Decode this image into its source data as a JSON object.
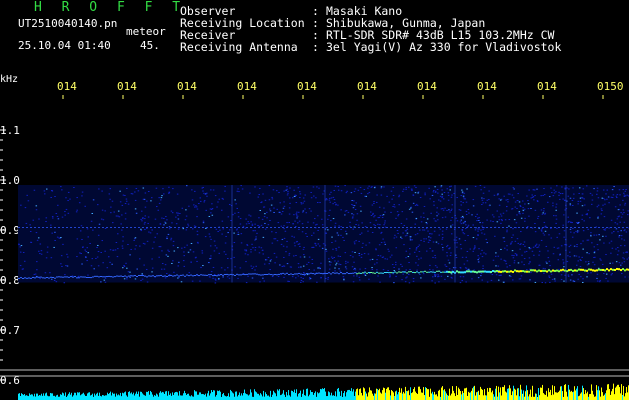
{
  "header": {
    "title": "H R O F F T",
    "filename": "UT2510040140.pn",
    "filename_suffix": "meteor",
    "datetime": "25.10.04 01:40",
    "count": "45."
  },
  "meta": [
    {
      "label": "Observer",
      "value": "Masaki Kano"
    },
    {
      "label": "Receiving Location",
      "value": "Shibukawa, Gunma, Japan"
    },
    {
      "label": "Receiver",
      "value": "RTL-SDR SDR# 43dB L15 103.2MHz CW"
    },
    {
      "label": "Receiving Antenna",
      "value": "3el Yagi(V) Az 330 for Vladivostok"
    }
  ],
  "chart_data": {
    "type": "heatmap",
    "ylabel": "kHz",
    "x_ticks": [
      "014",
      "014",
      "014",
      "014",
      "014",
      "014",
      "014",
      "014",
      "014",
      "0150"
    ],
    "y_ticks": [
      "1.1",
      "1.0",
      "0.9",
      "0.8",
      "0.7",
      "0.6"
    ],
    "ylim": [
      0.6,
      1.1
    ],
    "grid": false,
    "colors": {
      "noise": "#1020c0",
      "signal": "#ffff00",
      "bright": "#ffffff",
      "bar": "#00e5ff"
    }
  }
}
